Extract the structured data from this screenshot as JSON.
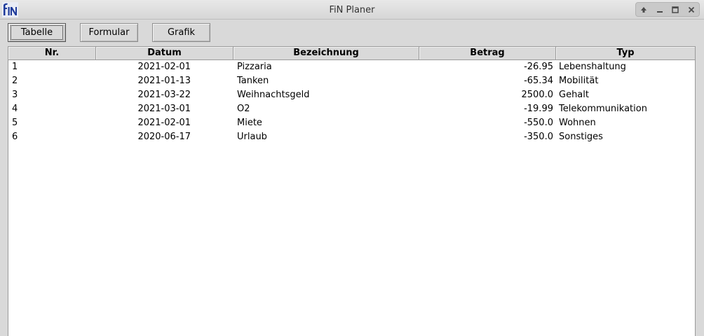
{
  "window": {
    "title": "FiN Planer"
  },
  "toolbar": {
    "tabelle_label": "Tabelle",
    "formular_label": "Formular",
    "grafik_label": "Grafik"
  },
  "table": {
    "columns": [
      "Nr.",
      "Datum",
      "Bezeichnung",
      "Betrag",
      "Typ"
    ],
    "rows": [
      [
        "1",
        "2021-02-01",
        "Pizzaria",
        "-26.95",
        "Lebenshaltung"
      ],
      [
        "2",
        "2021-01-13",
        "Tanken",
        "-65.34",
        "Mobilität"
      ],
      [
        "3",
        "2021-03-22",
        "Weihnachtsgeld",
        "2500.0",
        "Gehalt"
      ],
      [
        "4",
        "2021-03-01",
        "O2",
        "-19.99",
        "Telekommunikation"
      ],
      [
        "5",
        "2021-02-01",
        "Miete",
        "-550.0",
        "Wohnen"
      ],
      [
        "6",
        "2020-06-17",
        "Urlaub",
        "-350.0",
        "Sonstiges"
      ]
    ]
  },
  "colors": {
    "logo_blue": "#1f3b9b",
    "header_bg": "#d9d9d9"
  }
}
